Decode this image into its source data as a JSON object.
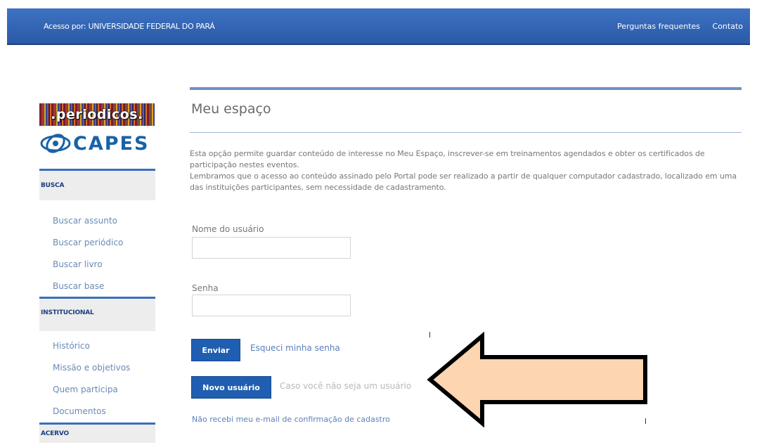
{
  "topbar": {
    "access": "Acesso por: UNIVERSIDADE FEDERAL DO PARÁ",
    "faq": "Perguntas frequentes",
    "contact": "Contato"
  },
  "logo": {
    "periodicos": ".periodicos.",
    "capes": "CAPES"
  },
  "sidebar": {
    "busca": {
      "title": "BUSCA",
      "items": [
        "Buscar assunto",
        "Buscar periódico",
        "Buscar livro",
        "Buscar base"
      ]
    },
    "institucional": {
      "title": "INSTITUCIONAL",
      "items": [
        "Histórico",
        "Missão e objetivos",
        "Quem participa",
        "Documentos"
      ]
    },
    "acervo": {
      "title": "ACERVO"
    }
  },
  "main": {
    "title": "Meu espaço",
    "intro_1": "Esta opção permite guardar conteúdo de interesse no Meu Espaço, inscrever-se em treinamentos agendados e obter os certificados de participação nestes eventos.",
    "intro_2": "Lembramos que o acesso ao conteúdo assinado pelo Portal pode ser realizado a partir de qualquer computador cadastrado, localizado em uma das instituições participantes, sem necessidade de cadastramento.",
    "username_label": "Nome do usuário",
    "username_value": "",
    "password_label": "Senha",
    "password_value": "",
    "submit": "Enviar",
    "forgot": "Esqueci minha senha",
    "new_user": "Novo usuário",
    "new_user_hint": "Caso você não seja um usuário",
    "resend": "Não recebi meu e-mail de confirmação de cadastro"
  },
  "colors": {
    "topbar": "#2f62b3",
    "button": "#1f5eb0",
    "arrow_fill": "#fdd5b1",
    "arrow_stroke": "#000000"
  },
  "overlay": {
    "arrow_direction": "left",
    "arrow_icon": "left-arrow-icon"
  }
}
